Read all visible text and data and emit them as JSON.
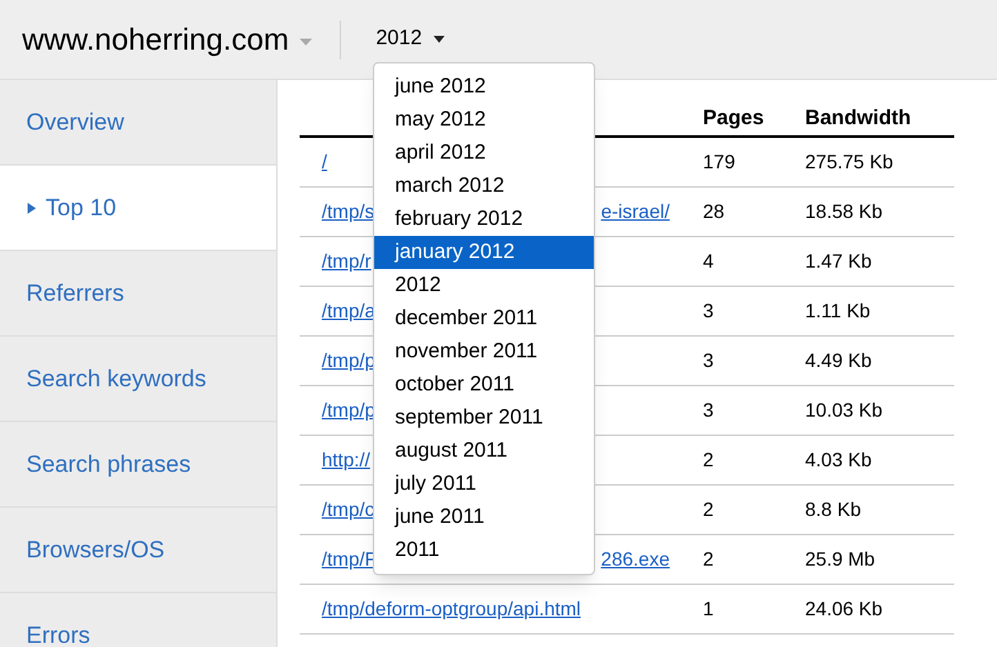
{
  "header": {
    "site": "www.noherring.com",
    "period": "2012"
  },
  "period_menu": [
    {
      "label": "june 2012",
      "selected": false
    },
    {
      "label": "may 2012",
      "selected": false
    },
    {
      "label": "april 2012",
      "selected": false
    },
    {
      "label": "march 2012",
      "selected": false
    },
    {
      "label": "february 2012",
      "selected": false
    },
    {
      "label": "january 2012",
      "selected": true
    },
    {
      "label": "2012",
      "selected": false
    },
    {
      "label": "december 2011",
      "selected": false
    },
    {
      "label": "november 2011",
      "selected": false
    },
    {
      "label": "october 2011",
      "selected": false
    },
    {
      "label": "september 2011",
      "selected": false
    },
    {
      "label": "august 2011",
      "selected": false
    },
    {
      "label": "july 2011",
      "selected": false
    },
    {
      "label": "june 2011",
      "selected": false
    },
    {
      "label": "2011",
      "selected": false
    }
  ],
  "sidebar": {
    "items": [
      {
        "label": "Overview",
        "selected": false
      },
      {
        "label": "Top 10",
        "selected": true
      },
      {
        "label": "Referrers",
        "selected": false
      },
      {
        "label": "Search keywords",
        "selected": false
      },
      {
        "label": "Search phrases",
        "selected": false
      },
      {
        "label": "Browsers/OS",
        "selected": false
      },
      {
        "label": "Errors",
        "selected": false
      }
    ]
  },
  "table": {
    "columns": [
      "Pages",
      "Bandwidth"
    ],
    "rows": [
      {
        "url": "/",
        "pages": "179",
        "bandwidth": "275.75 Kb"
      },
      {
        "url": "/tmp/s",
        "url_tail": "e-israel/",
        "pages": "28",
        "bandwidth": "18.58 Kb"
      },
      {
        "url": "/tmp/r",
        "pages": "4",
        "bandwidth": "1.47 Kb"
      },
      {
        "url": "/tmp/a",
        "pages": "3",
        "bandwidth": "1.11 Kb"
      },
      {
        "url": "/tmp/p",
        "pages": "3",
        "bandwidth": "4.49 Kb"
      },
      {
        "url": "/tmp/p",
        "pages": "3",
        "bandwidth": "10.03 Kb"
      },
      {
        "url": "http://",
        "pages": "2",
        "bandwidth": "4.03 Kb"
      },
      {
        "url": "/tmp/c",
        "pages": "2",
        "bandwidth": "8.8 Kb"
      },
      {
        "url": "/tmp/F",
        "url_tail": "286.exe",
        "pages": "2",
        "bandwidth": "25.9 Mb"
      },
      {
        "url": "/tmp/deform-optgroup/api.html",
        "pages": "1",
        "bandwidth": "24.06 Kb"
      }
    ]
  }
}
